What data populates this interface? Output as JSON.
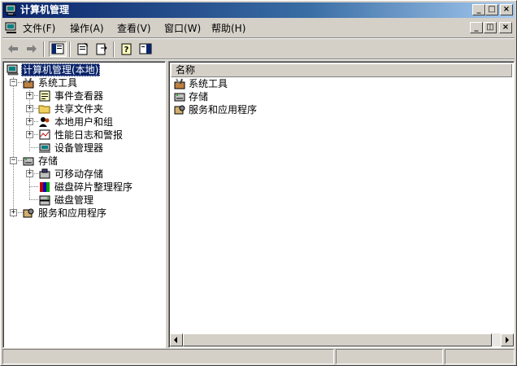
{
  "window": {
    "title": "计算机管理"
  },
  "menu": {
    "items": [
      "文件(F)",
      "操作(A)",
      "查看(V)",
      "窗口(W)",
      "帮助(H)"
    ]
  },
  "icons": {
    "app": "computer-management-icon",
    "back": "back-arrow-icon",
    "forward": "forward-arrow-icon",
    "show_hide_tree": "show-hide-tree-icon",
    "properties": "properties-icon",
    "export": "export-list-icon",
    "help": "help-icon",
    "show_hide_action": "show-hide-action-pane-icon"
  },
  "tree": {
    "root": "计算机管理(本地)",
    "system_tools": "系统工具",
    "event_viewer": "事件查看器",
    "shared_folders": "共享文件夹",
    "local_users": "本地用户和组",
    "perf_logs": "性能日志和警报",
    "device_manager": "设备管理器",
    "storage": "存储",
    "removable_storage": "可移动存储",
    "defrag": "磁盘碎片整理程序",
    "disk_mgmt": "磁盘管理",
    "services_apps": "服务和应用程序"
  },
  "list": {
    "header_name": "名称",
    "items": [
      "系统工具",
      "存储",
      "服务和应用程序"
    ]
  },
  "colors": {
    "selection": "#0a246a",
    "window_bg": "#d4d0c8"
  }
}
